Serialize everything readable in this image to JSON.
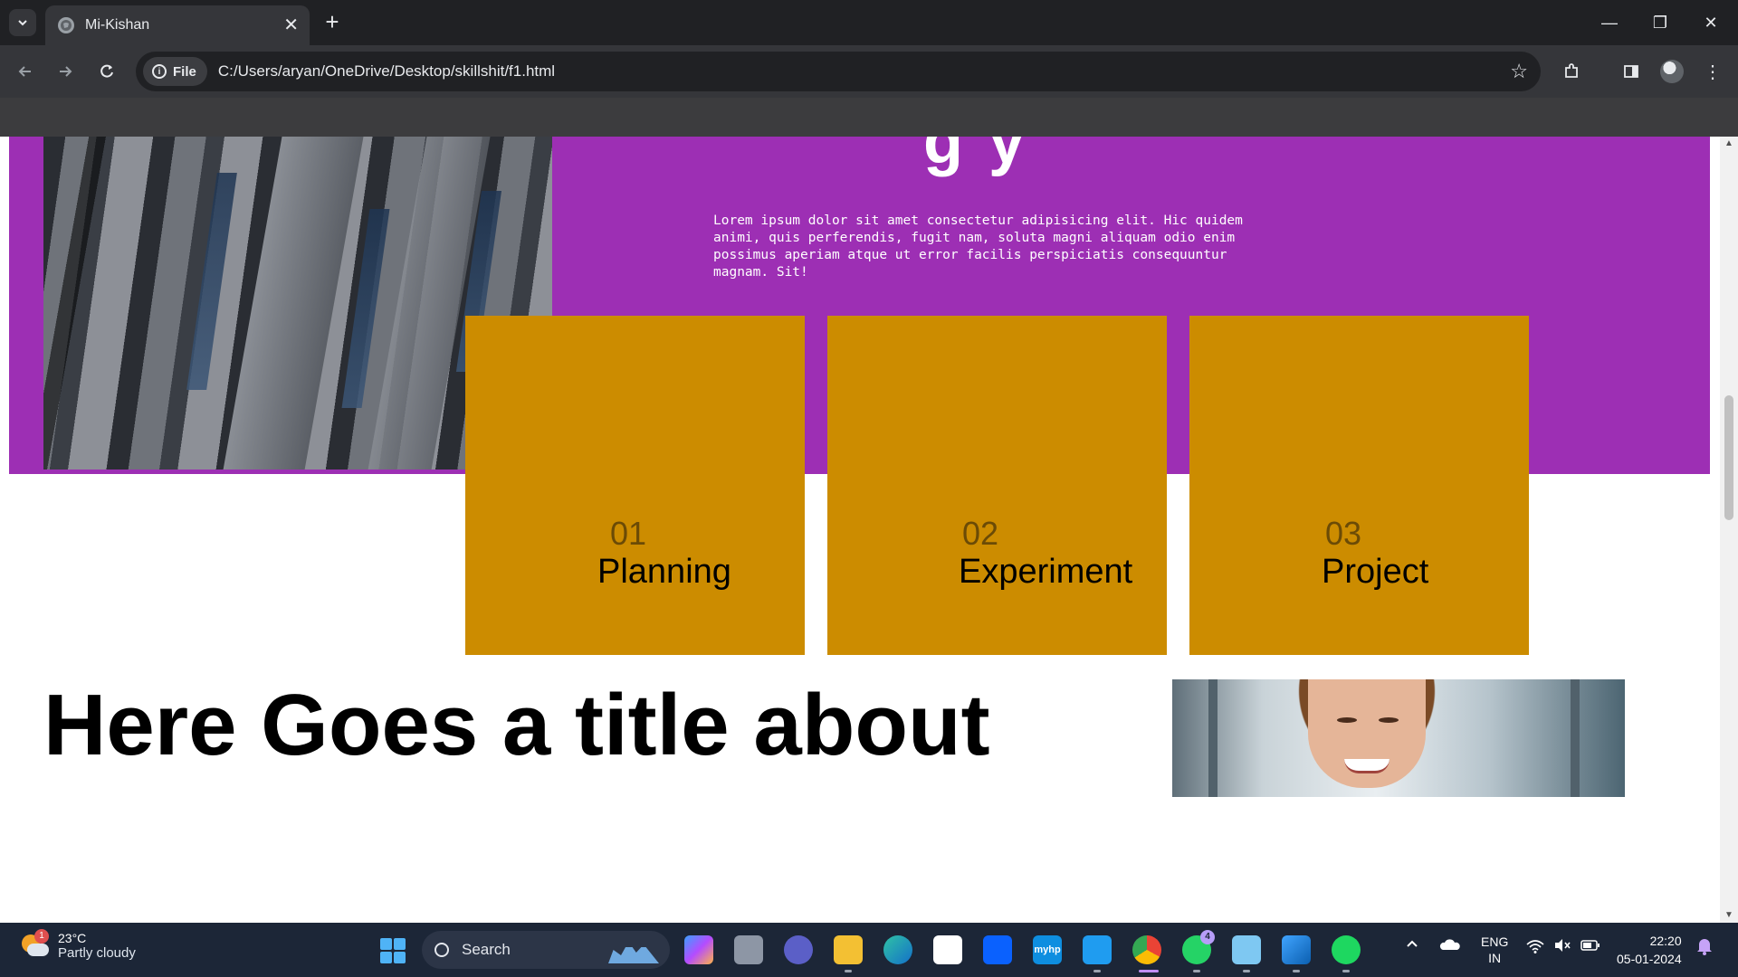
{
  "browser": {
    "tab_title": "Mi-Kishan",
    "tab_close": "✕",
    "new_tab": "+",
    "scheme_chip": "File",
    "url": "C:/Users/aryan/OneDrive/Desktop/skillshit/f1.html",
    "window_controls": {
      "minimize": "—",
      "restore": "❐",
      "close": "✕"
    }
  },
  "page": {
    "hero_text": "Lorem ipsum dolor sit amet consectetur adipisicing elit. Hic quidem animi, quis perferendis, fugit nam, soluta magni aliquam odio enim possimus aperiam atque ut error facilis perspiciatis consequuntur magnam. Sit!",
    "cards": [
      {
        "num": "01",
        "label": "Planning"
      },
      {
        "num": "02",
        "label": "Experiment"
      },
      {
        "num": "03",
        "label": "Project"
      }
    ],
    "big_title": "Here Goes a title about",
    "colors": {
      "hero_bg": "#9d2fb4",
      "card_bg": "#cc8c00"
    }
  },
  "taskbar": {
    "weather_badge": "1",
    "temperature": "23°C",
    "condition": "Partly cloudy",
    "search_placeholder": "Search",
    "whatsapp_badge": "4",
    "language": "ENG",
    "region": "IN",
    "time": "22:20",
    "date": "05-01-2024",
    "pinned_apps": [
      "copilot-icon",
      "task-view-icon",
      "chat-icon",
      "file-explorer-icon",
      "edge-icon",
      "store-icon",
      "dropbox-icon",
      "myhp-icon",
      "vscode-icon",
      "chrome-icon",
      "whatsapp-icon",
      "notepad-icon",
      "photos-icon",
      "spotify-icon"
    ]
  }
}
